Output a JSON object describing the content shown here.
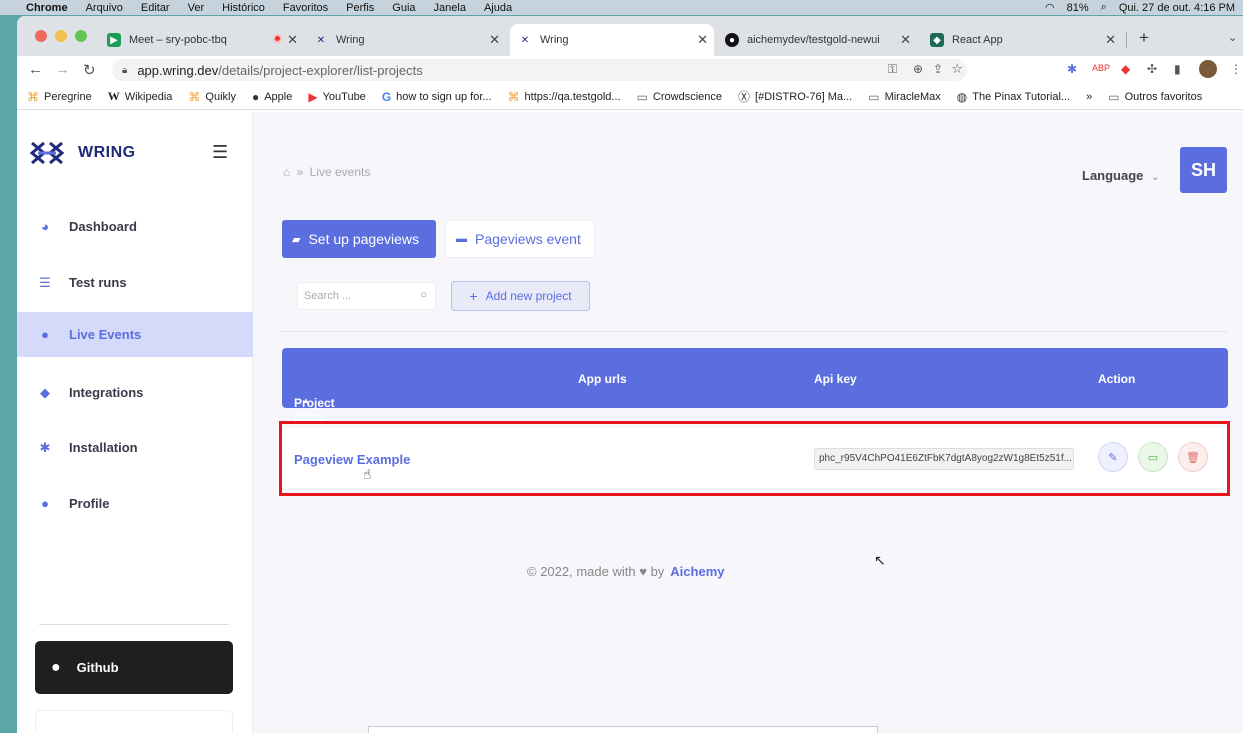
{
  "macbar": {
    "app": "Chrome",
    "menus": [
      "Arquivo",
      "Editar",
      "Ver",
      "Histórico",
      "Favoritos",
      "Perfis",
      "Guia",
      "Janela",
      "Ajuda"
    ],
    "battery": "81%",
    "datetime": "Qui. 27 de out.  4:16 PM"
  },
  "tabs": [
    {
      "label": "Meet – sry-pobc-tbq"
    },
    {
      "label": "Wring"
    },
    {
      "label": "Wring"
    },
    {
      "label": "aichemydev/testgold-newui"
    },
    {
      "label": "React App"
    }
  ],
  "address": {
    "host": "app.wring.dev",
    "path": "/details/project-explorer/list-projects"
  },
  "bookmarks": [
    "Peregrine",
    "Wikipedia",
    "Quikly",
    "Apple",
    "YouTube",
    "how to sign up for...",
    "https://qa.testgold...",
    "Crowdscience",
    "[#DISTRO-76] Ma...",
    "MiracleMax",
    "The Pinax Tutorial...",
    "»",
    "Outros favoritos"
  ],
  "sidebar": {
    "brand": "WRING",
    "items": [
      {
        "label": "Dashboard"
      },
      {
        "label": "Test runs"
      },
      {
        "label": "Live Events"
      },
      {
        "label": "Integrations"
      },
      {
        "label": "Installation"
      },
      {
        "label": "Profile"
      }
    ],
    "github": "Github"
  },
  "header": {
    "breadcrumb": "Live events",
    "language": "Language",
    "avatar": "SH"
  },
  "main": {
    "setup_button": "Set up pageviews",
    "event_button": "Pageviews event",
    "search_placeholder": "Search ...",
    "add_project": "Add new project",
    "columns": [
      "Project name",
      "App urls",
      "Api key",
      "Action"
    ],
    "rows": [
      {
        "name": "Pageview Example",
        "api_key": "phc_r95V4ChPO41E6ZtFbK7dgtA8yog2zW1g8Et5z51f..."
      }
    ]
  },
  "footer": {
    "text": "© 2022, made with",
    "by": "by",
    "brand": "Aichemy"
  },
  "colors": {
    "accent": "#5b6ee0",
    "highlight": "#e8141c",
    "sidebar_active": "#d6dafa"
  }
}
